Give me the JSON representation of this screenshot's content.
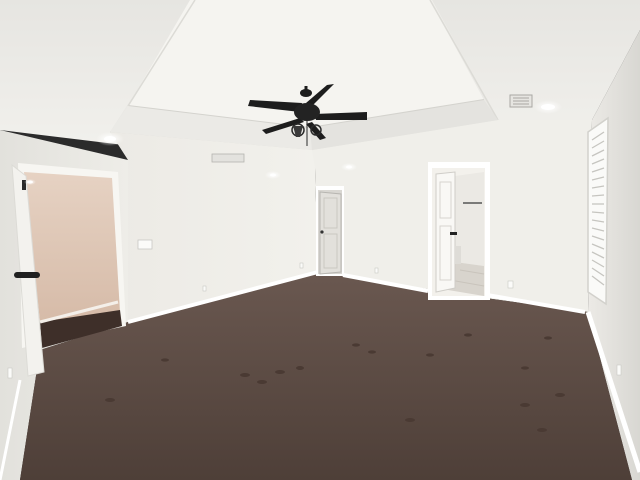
{
  "scene": {
    "colors": {
      "ceiling": "#f2f1ed",
      "wall": "#eeede8",
      "carpet": "#5d4c43",
      "trim": "#ffffff",
      "fan": "#1d1d1d",
      "hallway": "#e3cfc0"
    },
    "objects": [
      "ceiling-fan",
      "tray-ceiling",
      "recessed-light",
      "air-vent",
      "interior-door",
      "window-shutters",
      "carpet-floor",
      "baseboard",
      "light-switch",
      "electrical-outlet"
    ]
  }
}
